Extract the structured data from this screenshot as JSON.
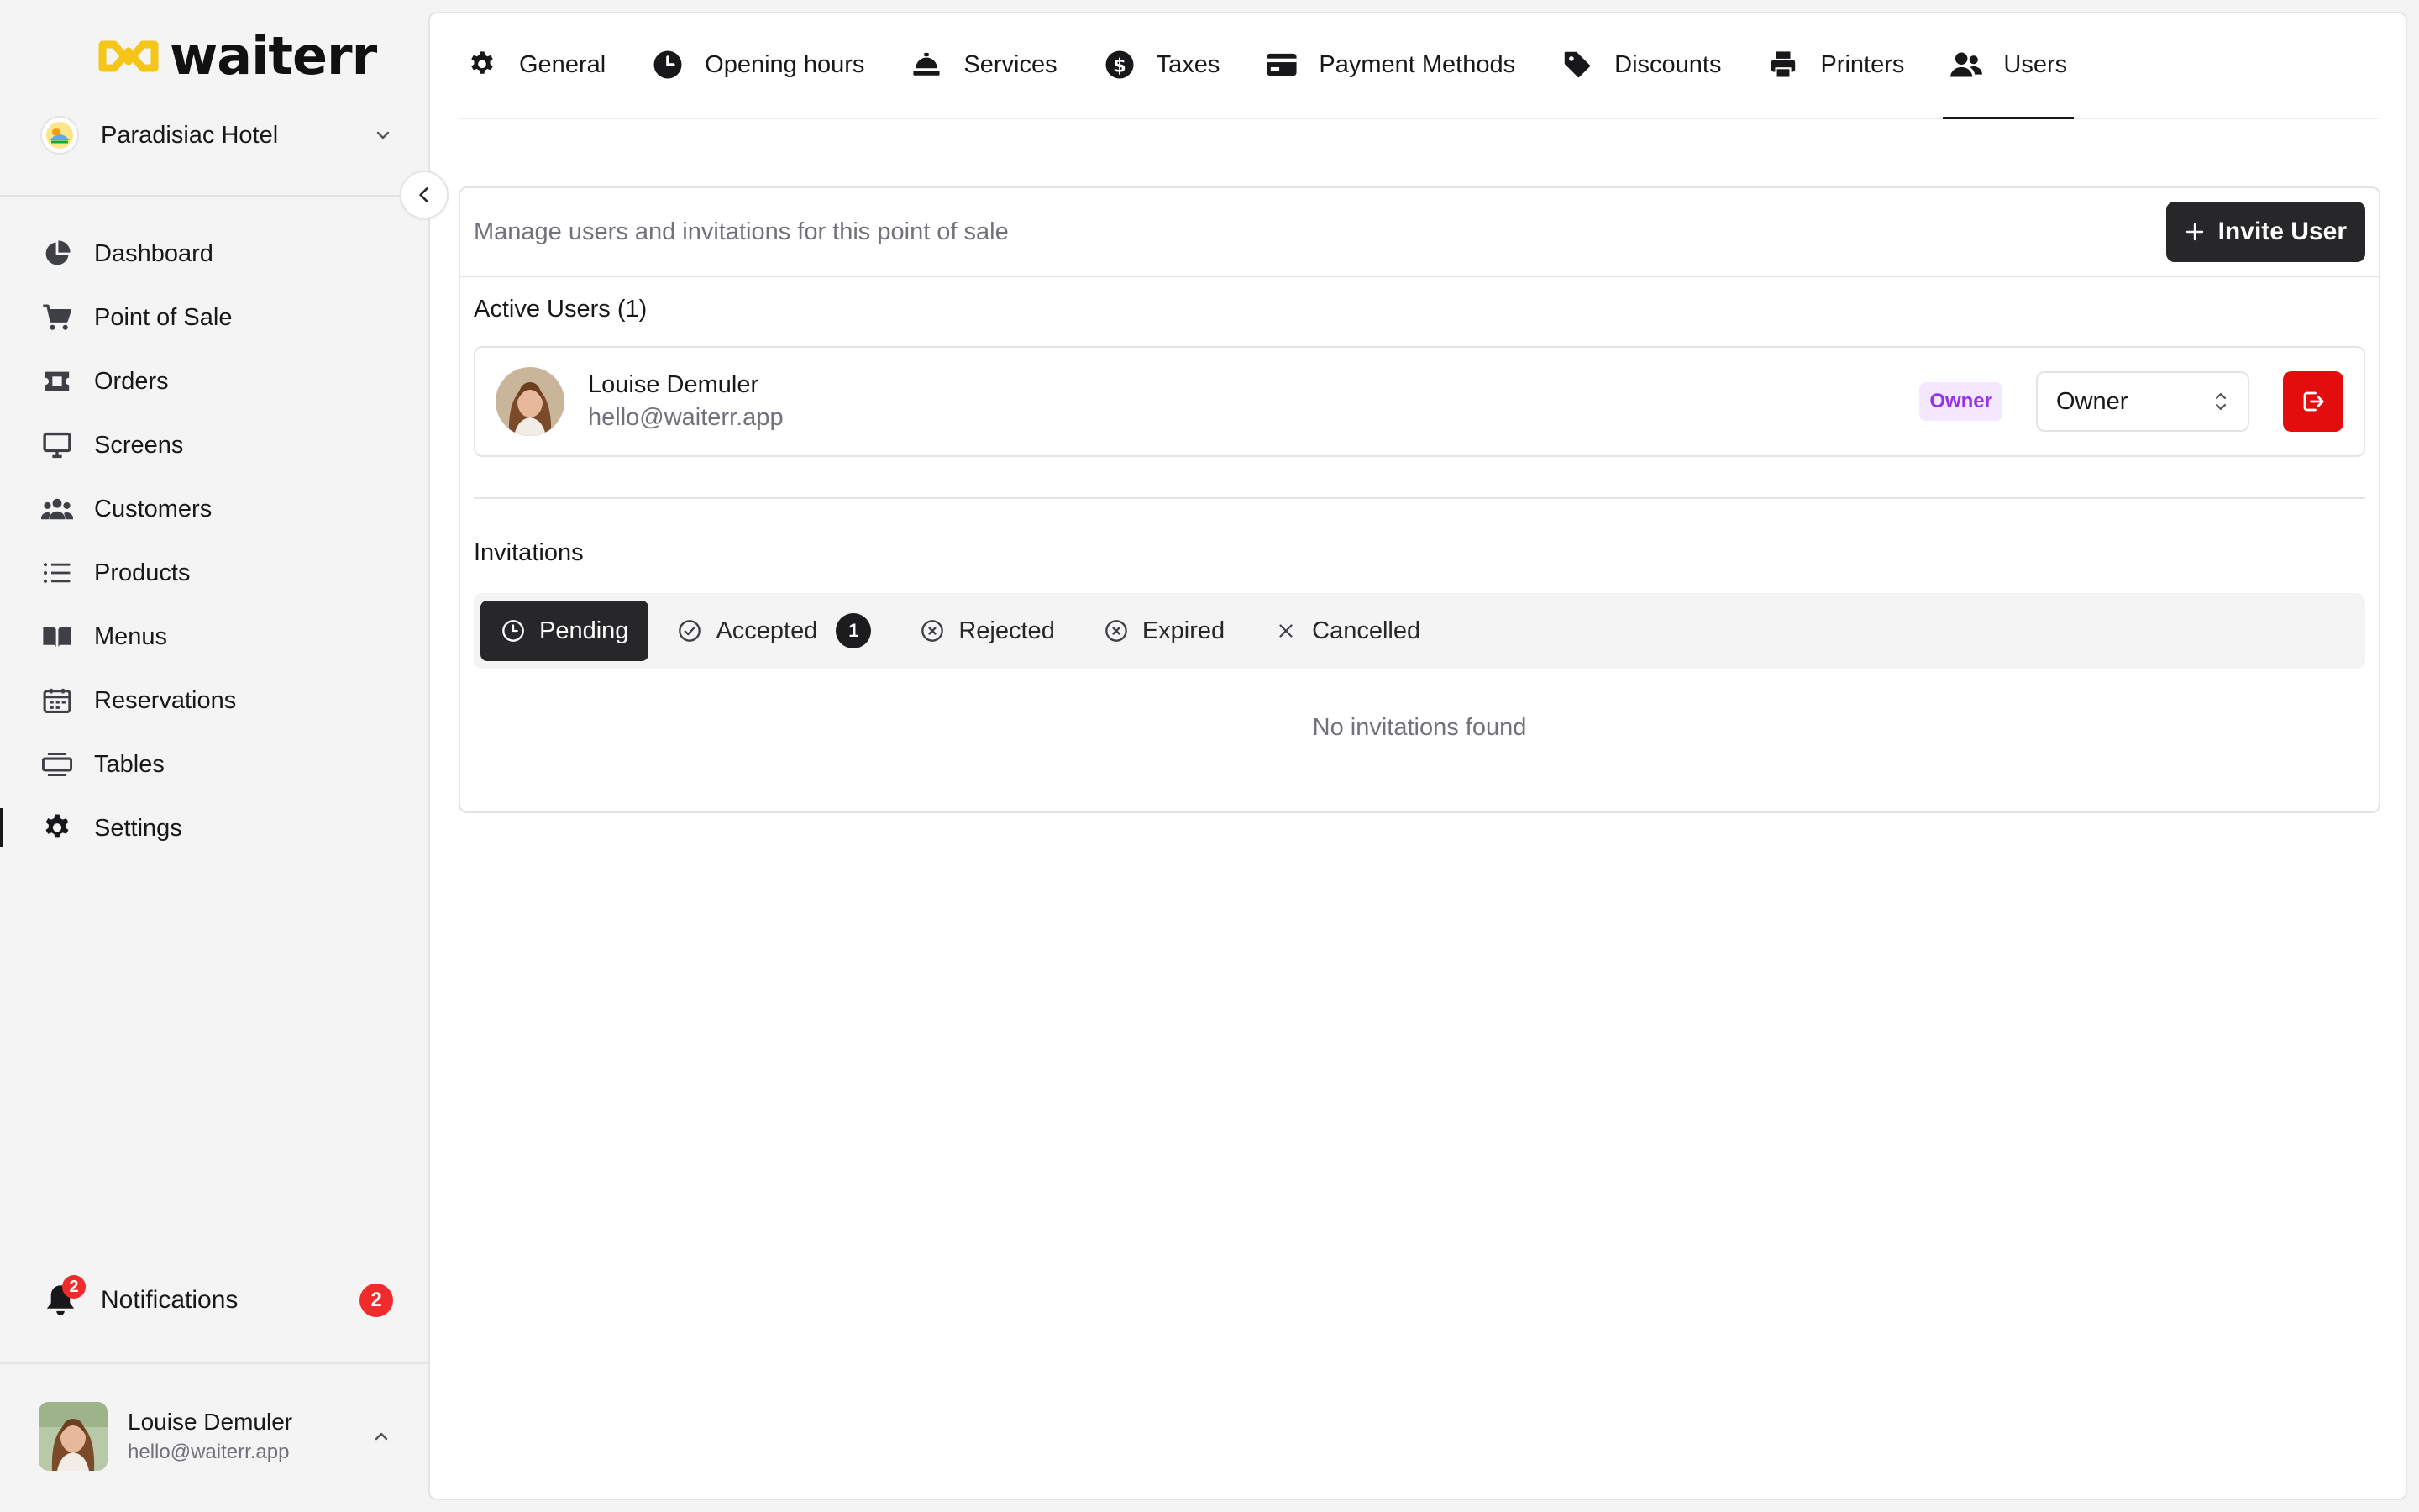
{
  "brand": {
    "name": "waiterr",
    "accent": "#f5c518"
  },
  "venue": {
    "name": "Paradisiac Hotel"
  },
  "sidebar": {
    "items": [
      {
        "label": "Dashboard",
        "icon": "pie-chart-icon"
      },
      {
        "label": "Point of Sale",
        "icon": "cart-icon"
      },
      {
        "label": "Orders",
        "icon": "ticket-icon"
      },
      {
        "label": "Screens",
        "icon": "monitor-icon"
      },
      {
        "label": "Customers",
        "icon": "users-icon"
      },
      {
        "label": "Products",
        "icon": "list-icon"
      },
      {
        "label": "Menus",
        "icon": "book-icon"
      },
      {
        "label": "Reservations",
        "icon": "calendar-icon"
      },
      {
        "label": "Tables",
        "icon": "table-icon"
      },
      {
        "label": "Settings",
        "icon": "gear-icon",
        "active": true
      }
    ],
    "notifications": {
      "label": "Notifications",
      "badge": "2",
      "count": "2"
    }
  },
  "current_user": {
    "name": "Louise Demuler",
    "email": "hello@waiterr.app"
  },
  "tabs": [
    {
      "label": "General",
      "icon": "gear-icon"
    },
    {
      "label": "Opening hours",
      "icon": "clock-icon"
    },
    {
      "label": "Services",
      "icon": "service-bell-icon"
    },
    {
      "label": "Taxes",
      "icon": "dollar-icon"
    },
    {
      "label": "Payment Methods",
      "icon": "credit-card-icon"
    },
    {
      "label": "Discounts",
      "icon": "tag-icon"
    },
    {
      "label": "Printers",
      "icon": "printer-icon"
    },
    {
      "label": "Users",
      "icon": "user-group-icon",
      "active": true
    }
  ],
  "users_panel": {
    "description": "Manage users and invitations for this point of sale",
    "invite_label": "Invite User",
    "active_title": "Active Users (1)",
    "active_users": [
      {
        "name": "Louise Demuler",
        "email": "hello@waiterr.app",
        "badge": "Owner",
        "role": "Owner"
      }
    ],
    "invitations_title": "Invitations",
    "invitation_tabs": [
      {
        "label": "Pending",
        "active": true
      },
      {
        "label": "Accepted",
        "count": "1"
      },
      {
        "label": "Rejected"
      },
      {
        "label": "Expired"
      },
      {
        "label": "Cancelled"
      }
    ],
    "empty_text": "No invitations found"
  }
}
